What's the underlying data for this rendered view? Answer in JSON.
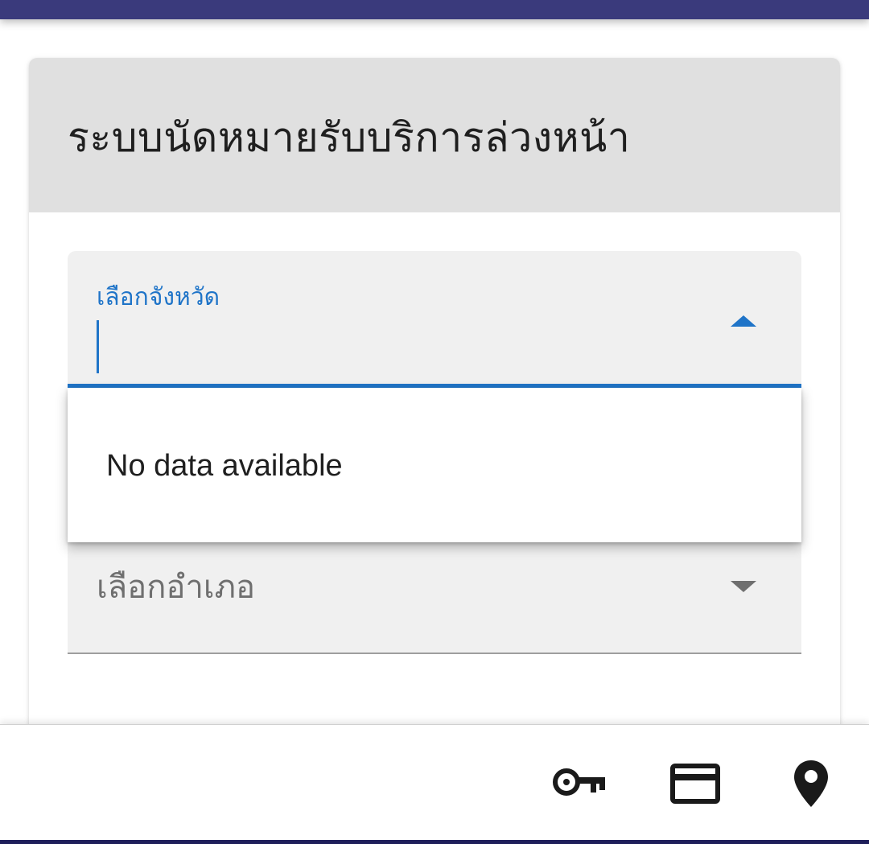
{
  "card": {
    "title": "ระบบนัดหมายรับบริการล่วงหน้า"
  },
  "province_field": {
    "label": "เลือกจังหวัด",
    "value": "",
    "state": "expanded"
  },
  "province_dropdown": {
    "empty_text": "No data available"
  },
  "district_field": {
    "placeholder": "เลือกอำเภอ",
    "state": "collapsed"
  },
  "bottom_nav": {
    "icons": [
      "key-icon",
      "credit-card-icon",
      "location-pin-icon"
    ]
  },
  "colors": {
    "app_bar": "#3a3a7c",
    "accent": "#1f74c8",
    "header_bg": "#e0e0e0",
    "field_bg": "#f0f0f0"
  }
}
